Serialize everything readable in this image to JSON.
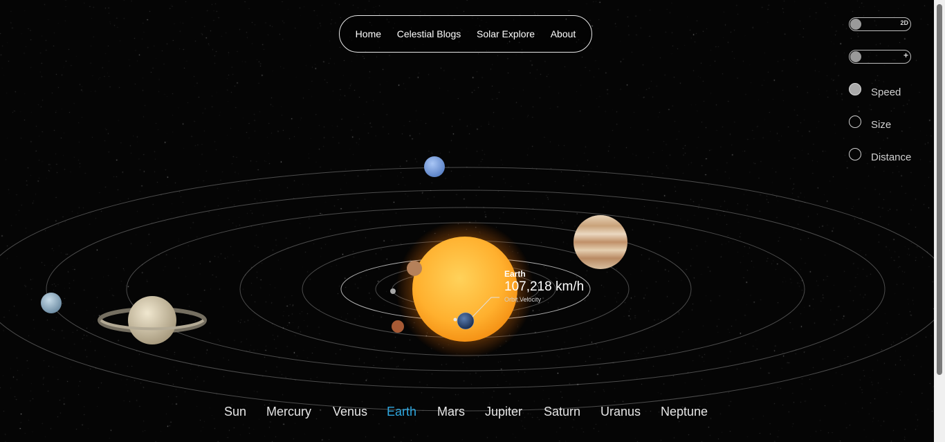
{
  "nav": {
    "items": [
      "Home",
      "Celestial Blogs",
      "Solar Explore",
      "About"
    ]
  },
  "controls": {
    "view_toggle_label": "2D",
    "zoom_toggle_label": "+",
    "radios": [
      {
        "label": "Speed",
        "checked": true
      },
      {
        "label": "Size",
        "checked": false
      },
      {
        "label": "Distance",
        "checked": false
      }
    ]
  },
  "info_popup": {
    "planet": "Earth",
    "value": "107,218 km/h",
    "metric": "Orbit Velocity"
  },
  "planet_nav": {
    "items": [
      "Sun",
      "Mercury",
      "Venus",
      "Earth",
      "Mars",
      "Jupiter",
      "Saturn",
      "Uranus",
      "Neptune"
    ],
    "active": "Earth"
  },
  "colors": {
    "background": "#050505",
    "active_planet_link": "#2fa8e0",
    "sun": "#ffb02e",
    "earth": "#2c4a7a",
    "neptune": "#7fa6e6",
    "uranus": "#a9c3d6",
    "jupiter": "#d9bb95",
    "saturn": "#d9cfb3",
    "mars": "#a65a35",
    "venus": "#c08a5a",
    "mercury": "#9a9a9a"
  }
}
